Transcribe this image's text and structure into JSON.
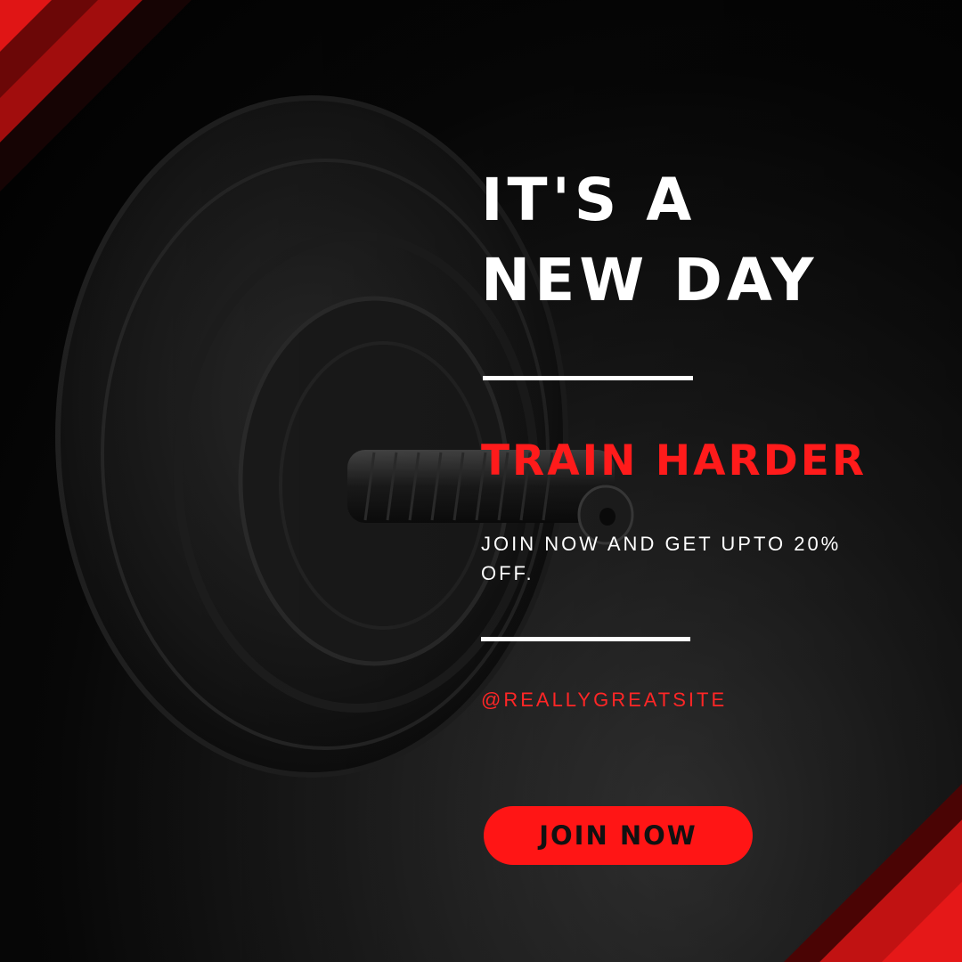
{
  "headline": {
    "line1": "IT'S A",
    "line2": "NEW DAY"
  },
  "subheading": "TRAIN HARDER",
  "offer_text": "JOIN NOW AND GET UPTO 20% OFF.",
  "social_handle": "@REALLYGREATSITE",
  "cta": {
    "label": "JOIN NOW"
  },
  "colors": {
    "accent": "#ff1b1b",
    "text": "#ffffff",
    "background": "#000000",
    "button_text": "#111111"
  },
  "background_image": "dumbbell-photo"
}
